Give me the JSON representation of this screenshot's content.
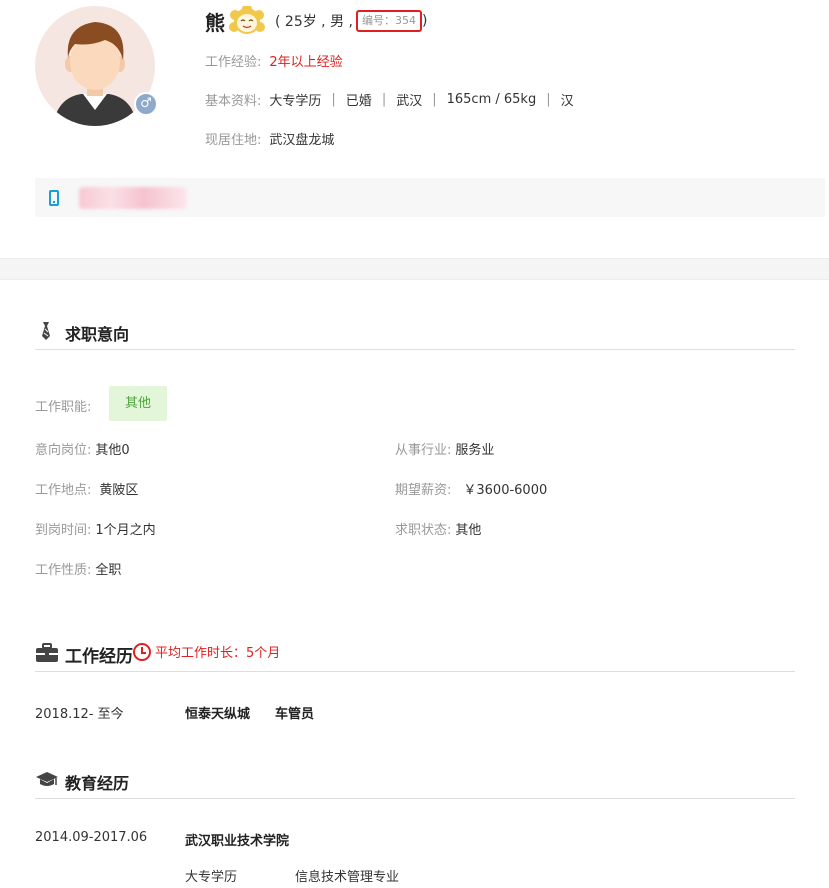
{
  "profile": {
    "name": "熊",
    "meta_open": "( 25岁 , 男 ,",
    "id_label": "编号：354",
    "id_tail": ")",
    "gender_symbol": "♂",
    "experience_label": "工作经验:",
    "experience_value": "2年以上经验",
    "basic_label": "基本资料:",
    "basic_items": [
      "大专学历",
      "已婚",
      "武汉",
      "165cm / 65kg",
      "汉"
    ],
    "residence_label": "现居住地:",
    "residence_value": "武汉盘龙城"
  },
  "job_intention": {
    "title": "求职意向",
    "function_label": "工作职能:",
    "function_tag": "其他",
    "position_label": "意向岗位:",
    "position_value": "其他0",
    "industry_label": "从事行业:",
    "industry_value": "服务业",
    "location_label": "工作地点:",
    "location_value": "黄陂区",
    "salary_label": "期望薪资:",
    "salary_value": "￥3600-6000",
    "arrival_label": "到岗时间:",
    "arrival_value": "1个月之内",
    "status_label": "求职状态:",
    "status_value": "其他",
    "nature_label": "工作性质:",
    "nature_value": "全职"
  },
  "work_experience": {
    "title": "工作经历",
    "avg_label": "平均工作时长：5个月",
    "items": [
      {
        "period": "2018.12- 至今",
        "company": "恒泰天纵城",
        "position": "车管员"
      }
    ]
  },
  "education": {
    "title": "教育经历",
    "items": [
      {
        "period": "2014.09-2017.06",
        "school": "武汉职业技术学院",
        "degree": "大专学历",
        "major": "信息技术管理专业"
      }
    ]
  },
  "colors": {
    "accent_red": "#e02020",
    "tag_green_bg": "#e3f6da",
    "tag_green_text": "#4ea53c",
    "phone_blue": "#1a9ed8",
    "gender_badge": "#8fa9cc"
  },
  "icons": [
    "avatar-icon",
    "male-icon",
    "smiley-sticker-icon",
    "phone-icon",
    "tie-icon",
    "briefcase-icon",
    "clock-icon",
    "graduation-cap-icon"
  ]
}
